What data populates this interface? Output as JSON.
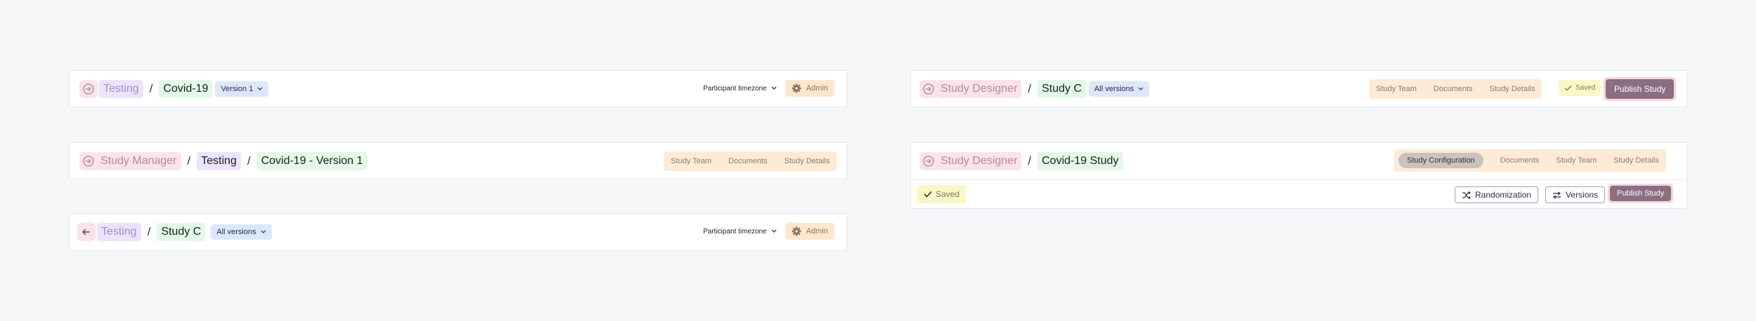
{
  "bar1": {
    "crumb_parent": "Testing",
    "crumb_current": "Covid-19",
    "version_select": "Version 1",
    "timezone": "Participant timezone",
    "admin_label": "Admin"
  },
  "bar2": {
    "crumb_root": "Study Manager",
    "crumb_parent": "Testing",
    "crumb_current": "Covid-19 - Version 1",
    "tabs": [
      "Study Team",
      "Documents",
      "Study Details"
    ]
  },
  "bar3": {
    "crumb_parent": "Testing",
    "crumb_current": "Study C",
    "version_select": "All versions",
    "timezone": "Participant timezone",
    "admin_label": "Admin"
  },
  "bar4": {
    "crumb_root": "Study Designer",
    "crumb_current": "Study C",
    "version_select": "All versions",
    "tabs": [
      "Study Team",
      "Documents",
      "Study Details"
    ],
    "saved_label": "Saved",
    "publish_label": "Publish Study"
  },
  "bar5": {
    "crumb_root": "Study Designer",
    "crumb_current": "Covid-19 Study",
    "tabs": [
      "Study Configuration",
      "Documents",
      "Study Team",
      "Study Details"
    ],
    "saved_label": "Saved",
    "randomization_label": "Randomization",
    "versions_label": "Versions",
    "publish_label": "Publish Study"
  },
  "colors": {
    "page_bg": "#f5f6f8",
    "publish": "#8a6f82",
    "tabs_bg": "#fdebd6",
    "select_bg": "#dde7fb"
  }
}
